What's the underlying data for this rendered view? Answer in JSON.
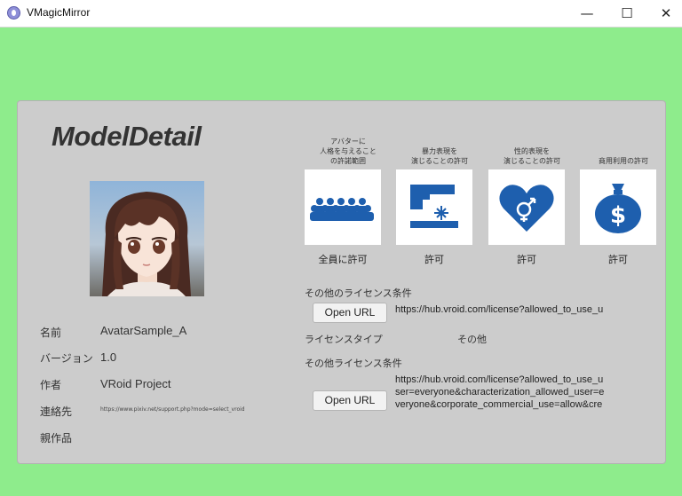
{
  "window": {
    "title": "VMagicMirror",
    "minimize": "—",
    "maximize": "☐",
    "close": "✕"
  },
  "model": {
    "title": "ModelDetail",
    "info": [
      {
        "label": "名前",
        "value": "AvatarSample_A"
      },
      {
        "label": "バージョン",
        "value": "1.0"
      },
      {
        "label": "作者",
        "value": "VRoid Project"
      },
      {
        "label": "連絡先",
        "value": "https://www.pixiv.net/support.php?mode=select_vroid"
      },
      {
        "label": "親作品",
        "value": ""
      }
    ]
  },
  "permissions": [
    {
      "heading": [
        "アバターに",
        "人格を与えること",
        "の許諾範囲"
      ],
      "value": "全員に許可",
      "icon": "people-icon"
    },
    {
      "heading": [
        "暴力表現を",
        "演じることの許可"
      ],
      "value": "許可",
      "icon": "gun-icon"
    },
    {
      "heading": [
        "性的表現を",
        "演じることの許可"
      ],
      "value": "許可",
      "icon": "heart-gender-icon"
    },
    {
      "heading": [
        "商用利用の許可"
      ],
      "value": "許可",
      "icon": "money-bag-icon"
    }
  ],
  "license": {
    "other_conditions_label": "その他のライセンス条件",
    "other_conditions_button": "Open URL",
    "other_conditions_url": "https://hub.vroid.com/license?allowed_to_use_u",
    "type_label": "ライセンスタイプ",
    "type_value": "その他",
    "other_license_label": "その他ライセンス条件",
    "other_license_button": "Open URL",
    "other_license_url_lines": [
      "https://hub.vroid.com/license?allowed_to_use_u",
      "ser=everyone&characterization_allowed_user=e",
      "veryone&corporate_commercial_use=allow&cre"
    ]
  },
  "colors": {
    "background": "#8eec8c",
    "panel": "#cccccc",
    "icon_blue": "#1e5fae"
  }
}
